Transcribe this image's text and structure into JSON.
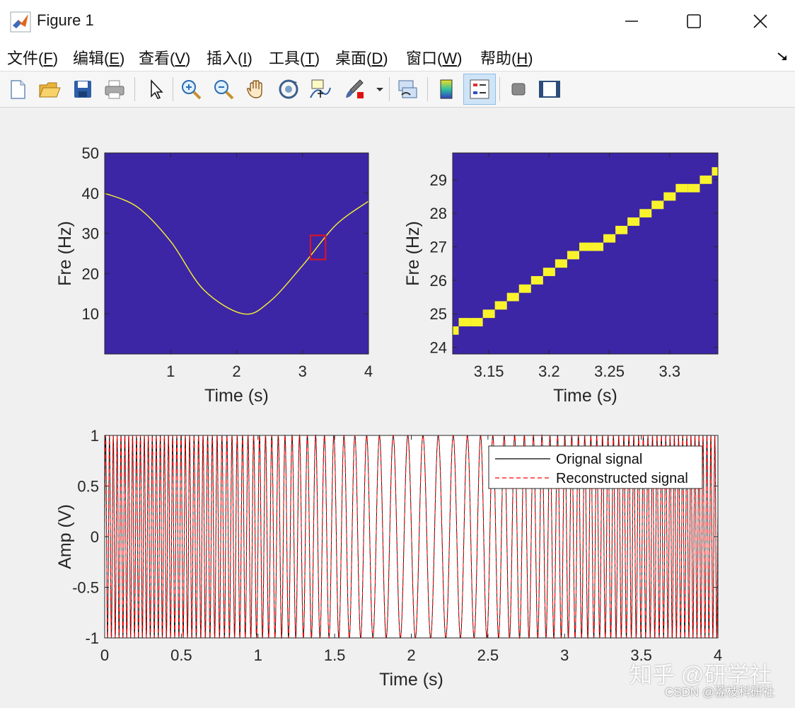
{
  "window": {
    "title": "Figure 1"
  },
  "menu": [
    {
      "text": "文件(",
      "key": "F",
      "end": ")"
    },
    {
      "text": "编辑(",
      "key": "E",
      "end": ")"
    },
    {
      "text": "查看(",
      "key": "V",
      "end": ")"
    },
    {
      "text": "插入(",
      "key": "I",
      "end": ")"
    },
    {
      "text": "工具(",
      "key": "T",
      "end": ")"
    },
    {
      "text": "桌面(",
      "key": "D",
      "end": ")"
    },
    {
      "text": "窗口(",
      "key": "W",
      "end": ")"
    },
    {
      "text": "帮助(",
      "key": "H",
      "end": ")"
    }
  ],
  "toolbar": [
    "new-figure-icon",
    "open-icon",
    "save-icon",
    "print-icon",
    "pointer-icon",
    "zoom-in-icon",
    "zoom-out-icon",
    "pan-icon",
    "rotate-3d-icon",
    "data-cursor-icon",
    "brush-icon",
    "link-plot-icon",
    "colorbar-icon",
    "legend-icon",
    "hide-plot-tools-icon",
    "show-plot-tools-icon"
  ],
  "colors": {
    "plot_bg": "#3c26a6",
    "ridge": "#f9f32c",
    "highlight_box": "#e3141c",
    "orig_line": "#000000",
    "recon_line": "#ff0000"
  },
  "chart_data": [
    {
      "type": "heatmap",
      "xlabel": "Time (s)",
      "ylabel": "Fre (Hz)",
      "xlim": [
        0,
        4
      ],
      "ylim": [
        0,
        50
      ],
      "xticks": [
        1,
        2,
        3,
        4
      ],
      "yticks": [
        10,
        20,
        30,
        40,
        50
      ],
      "ridge": {
        "x": [
          0,
          0.5,
          1.0,
          1.5,
          2.1,
          2.5,
          3.0,
          3.5,
          4.0
        ],
        "y": [
          40,
          36.5,
          28,
          16,
          10,
          13,
          22,
          32,
          38
        ]
      },
      "highlight_box": {
        "x": [
          3.12,
          3.35
        ],
        "y": [
          23.5,
          29.5
        ]
      }
    },
    {
      "type": "heatmap",
      "xlabel": "Time (s)",
      "ylabel": "Fre (Hz)",
      "xlim": [
        3.12,
        3.34
      ],
      "ylim": [
        23.8,
        29.8
      ],
      "xticks": [
        3.15,
        3.2,
        3.25,
        3.3
      ],
      "yticks": [
        24,
        25,
        26,
        27,
        28,
        29
      ],
      "ridge": {
        "x": [
          3.12,
          3.13,
          3.14,
          3.15,
          3.16,
          3.17,
          3.18,
          3.19,
          3.2,
          3.21,
          3.22,
          3.23,
          3.24,
          3.25,
          3.26,
          3.27,
          3.28,
          3.29,
          3.3,
          3.31,
          3.32,
          3.33,
          3.34
        ],
        "y": [
          24.5,
          24.75,
          24.75,
          25.0,
          25.25,
          25.5,
          25.75,
          26.0,
          26.25,
          26.5,
          26.75,
          27.0,
          27.0,
          27.25,
          27.5,
          27.75,
          28.0,
          28.25,
          28.5,
          28.75,
          28.75,
          29.0,
          29.25
        ]
      }
    },
    {
      "type": "line",
      "xlabel": "Time (s)",
      "ylabel": "Amp (V)",
      "xlim": [
        0,
        4
      ],
      "ylim": [
        -1,
        1
      ],
      "xticks": [
        0,
        0.5,
        1,
        1.5,
        2,
        2.5,
        3,
        3.5,
        4
      ],
      "yticks": [
        -1,
        -0.5,
        0,
        0.5,
        1
      ],
      "series": [
        {
          "name": "Orignal signal",
          "style": "solid"
        },
        {
          "name": "Reconstructed signal",
          "style": "dashed"
        }
      ]
    }
  ],
  "watermark": {
    "line1": "知乎 @研学社",
    "line2": "CSDN @荔枝科研社"
  }
}
